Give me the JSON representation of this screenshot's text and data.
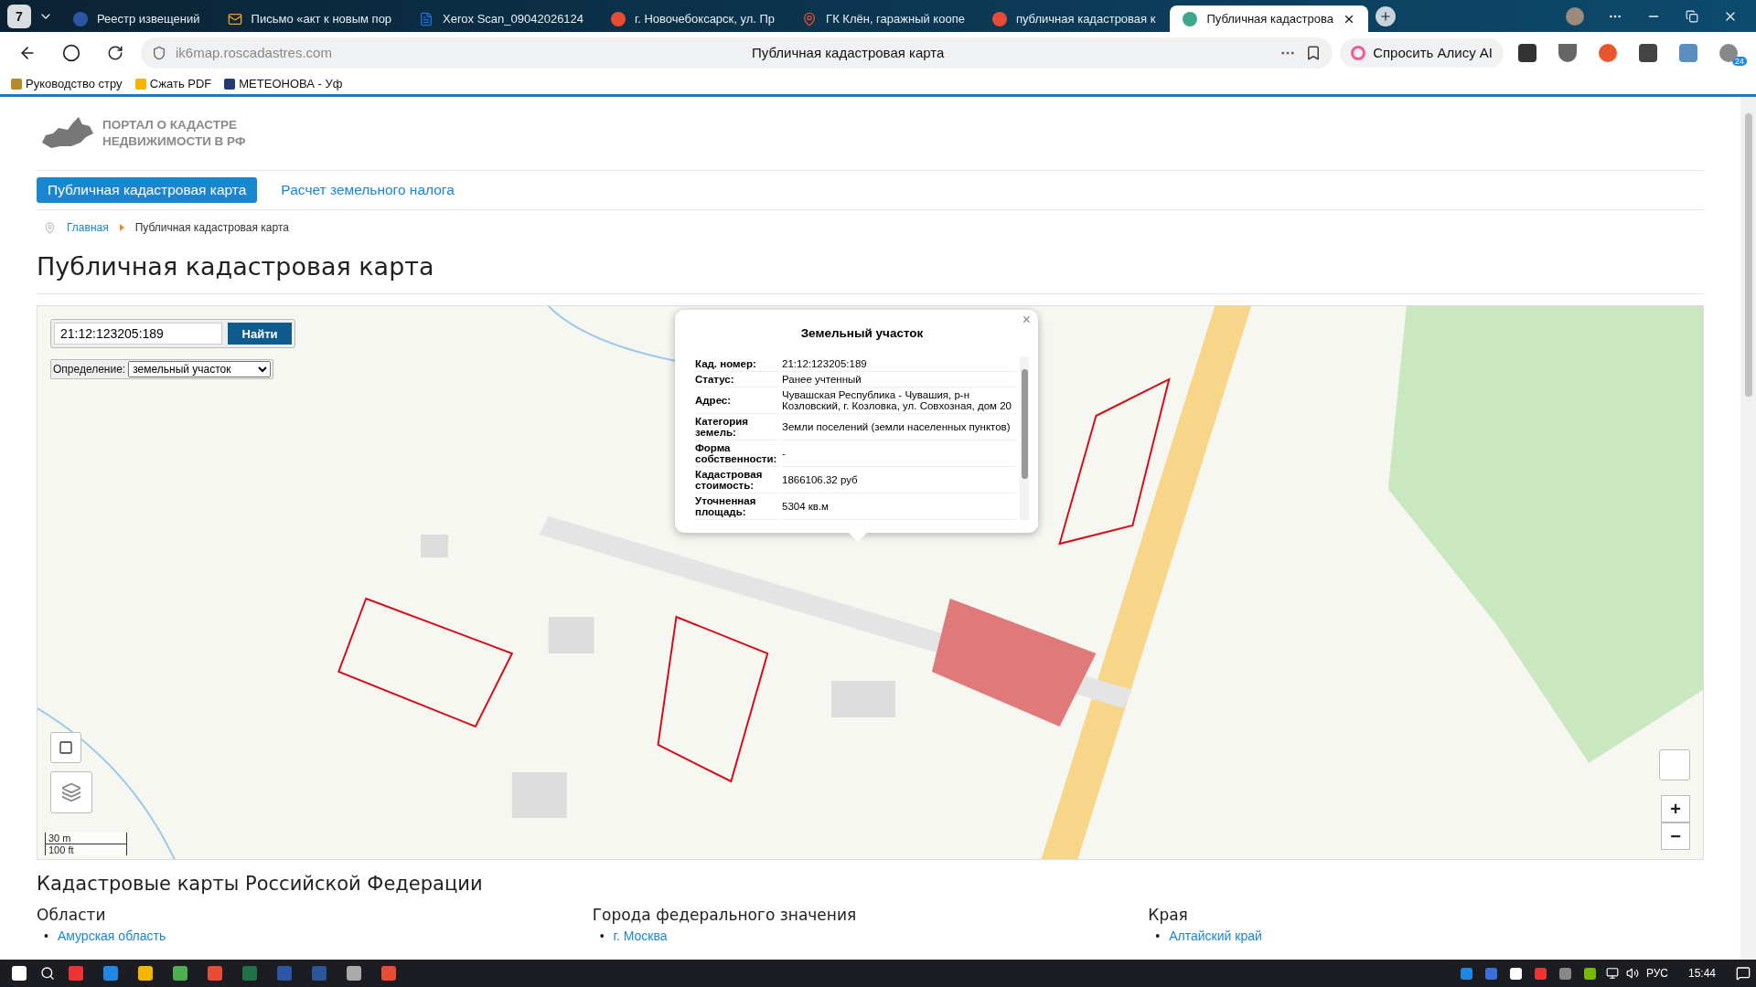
{
  "browser": {
    "tab_counter": "7",
    "tabs": [
      {
        "title": "Реестр извещений",
        "kind": "emblem",
        "selected": false
      },
      {
        "title": "Письмо «акт к новым пор",
        "kind": "mail",
        "selected": false
      },
      {
        "title": "Xerox Scan_09042026124",
        "kind": "document",
        "selected": false
      },
      {
        "title": "г. Новочебоксарск, ул. Пр",
        "kind": "yandex",
        "selected": false
      },
      {
        "title": "ГК Клён, гаражный коопе",
        "kind": "pin",
        "selected": false
      },
      {
        "title": "публичная кадастровая к",
        "kind": "yandex",
        "selected": false
      },
      {
        "title": "Публичная кадастрова",
        "kind": "site",
        "selected": true
      }
    ],
    "address": "ik6map.roscadastres.com",
    "page_title": "Публичная кадастровая карта",
    "alice": "Спросить Алису AI",
    "badge": "24",
    "bookmarks": [
      "Руководство стру",
      "Сжать PDF",
      "МЕТЕОНОВА - Уф"
    ]
  },
  "site": {
    "logo_lines": [
      "ПОРТАЛ О КАДАСТРЕ",
      "НЕДВИЖИМОСТИ В РФ"
    ],
    "nav": [
      {
        "label": "Публичная кадастровая карта",
        "selected": true
      },
      {
        "label": "Расчет земельного налога",
        "selected": false
      }
    ],
    "breadcrumb": [
      "Главная",
      "Публичная кадастровая карта"
    ],
    "heading": "Публичная кадастровая карта"
  },
  "map": {
    "search": {
      "value": "21:12:123205:189",
      "button": "Найти"
    },
    "definition": {
      "label": "Определение:",
      "value": "земельный участок"
    },
    "popup": {
      "title": "Земельный участок",
      "close": "×",
      "rows": [
        {
          "label": "Кад. номер:",
          "value": "21:12:123205:189"
        },
        {
          "label": "Статус:",
          "value": "Ранее учтенный"
        },
        {
          "label": "Адрес:",
          "value": "Чувашская Республика - Чувашия, р-н Козловский, г. Козловка, ул. Совхозная, дом 20"
        },
        {
          "label": "Категория земель:",
          "value": "Земли поселений (земли населенных пунктов)"
        },
        {
          "label": "Форма собственности:",
          "value": "-"
        },
        {
          "label": "Кадастровая стоимость:",
          "value": "1866106.32 руб"
        },
        {
          "label": "Уточненная площадь:",
          "value": "5304 кв.м"
        }
      ]
    },
    "scale": [
      "30 m",
      "100 ft"
    ],
    "zoom": [
      "+",
      "−"
    ]
  },
  "regions": {
    "title": "Кадастровые карты Российской Федерации",
    "columns": [
      {
        "heading": "Области",
        "items": [
          {
            "bullet": "•",
            "label": "Амурская область"
          }
        ]
      },
      {
        "heading": "Города федерального значения",
        "items": [
          {
            "bullet": "•",
            "label": "г. Москва"
          }
        ]
      },
      {
        "heading": "Края",
        "items": [
          {
            "bullet": "•",
            "label": "Алтайский край"
          }
        ]
      }
    ]
  },
  "taskbar": {
    "lang": "РУС",
    "time": "15:44"
  }
}
